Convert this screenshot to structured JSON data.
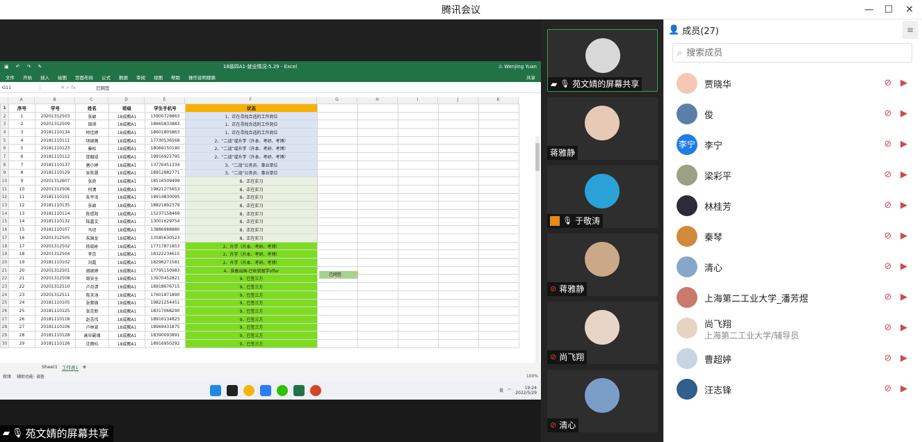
{
  "window": {
    "title": "腾讯会议"
  },
  "share": {
    "label": "苑文婧的屏幕共享"
  },
  "excel": {
    "title": "18级四A1-就业情况-5.29 - Excel",
    "user": "Wenjing Yuan",
    "ribbon": [
      "文件",
      "开始",
      "插入",
      "绘图",
      "页面布局",
      "公式",
      "数据",
      "审阅",
      "视图",
      "帮助",
      "操作说明搜索"
    ],
    "share_btn": "共享",
    "namebox": "G11",
    "formula": "已网签",
    "columns": [
      "A",
      "B",
      "C",
      "D",
      "E",
      "F",
      "G",
      "H",
      "I",
      "J",
      "K"
    ],
    "headers": [
      "序号",
      "学号",
      "姓名",
      "班级",
      "学生手机号",
      "状态"
    ],
    "rows": [
      [
        "1",
        "20201312503",
        "张颖",
        "18成教A1",
        "15900729863",
        "1、正在寻找合适的工作岗位",
        "blue"
      ],
      [
        "2",
        "20201312509",
        "田琪",
        "18成教A1",
        "18665833883",
        "1、正在寻找合适的工作岗位",
        "blue"
      ],
      [
        "3",
        "20181110134",
        "柯佳婷",
        "18成教A1",
        "18601805863",
        "1、正在寻找合适的工作岗位",
        "blue"
      ],
      [
        "4",
        "20181110111",
        "项婉薇",
        "18成教A1",
        "17730536568",
        "2、“二战”或升学（升本、考研、考博）",
        "blue"
      ],
      [
        "5",
        "20181110123",
        "秦松",
        "18成教A1",
        "18069150190",
        "2、“二战”或升学（升本、考研、考博）",
        "blue"
      ],
      [
        "6",
        "20181110112",
        "庞翰成",
        "18成教A1",
        "19916921795",
        "2、“二战”或升学（升本、考研、考博）",
        "blue"
      ],
      [
        "7",
        "20181110137",
        "唐小婷",
        "18成教A1",
        "13776451334",
        "3、“二战”公务员、事业单位",
        "blue"
      ],
      [
        "8",
        "20181110129",
        "吴陈晟",
        "18成教A1",
        "18912882771",
        "3、“二战”公务员、事业单位",
        "blue"
      ],
      [
        "9",
        "20201312607",
        "张奇",
        "18成教A1",
        "18516509499",
        "8、正在实习",
        "light"
      ],
      [
        "10",
        "20201312506",
        "何潇",
        "18成教A1",
        "19821275653",
        "8、正在实习",
        "light"
      ],
      [
        "11",
        "20181110101",
        "朱平泽",
        "18成教A1",
        "18914830095",
        "8、正在实习",
        "light"
      ],
      [
        "12",
        "20181110135",
        "张颖",
        "18成教A1",
        "18821892379",
        "8、正在实习",
        "light"
      ],
      [
        "13",
        "20181110114",
        "陈煜阳",
        "18成教A1",
        "15237158469",
        "8、正在实习",
        "light"
      ],
      [
        "14",
        "20181110132",
        "陆嘉文",
        "18成教A1",
        "13001629754",
        "8、正在实习",
        "light"
      ],
      [
        "15",
        "20181110107",
        "马坦",
        "18成教A1",
        "13886988880",
        "8、正在实习",
        "light"
      ],
      [
        "16",
        "20201312505",
        "朱国龙",
        "18成教A1",
        "13585630523",
        "8、正在实习",
        "light"
      ],
      [
        "17",
        "20201312502",
        "杨晓彬",
        "18成教A1",
        "17717871853",
        "2、升学（升本、考研、考博）",
        "green"
      ],
      [
        "18",
        "20201312504",
        "李京",
        "18成教A1",
        "18122234615",
        "2、升学（升本、考研、考博）",
        "green"
      ],
      [
        "19",
        "20181110102",
        "刘磊",
        "18成教A1",
        "18296271581",
        "2、升学（升本、考研、考博）",
        "green"
      ],
      [
        "20",
        "20201312501",
        "胡婉婷",
        "18成教A1",
        "17795150983",
        "4、准备出国-已收到留学offer",
        "green"
      ],
      [
        "21",
        "20201312508",
        "周安全",
        "18成教A1",
        "13970452821",
        "9、已签三方",
        "green"
      ],
      [
        "22",
        "20201312510",
        "卢月清",
        "18成教A1",
        "18918676715",
        "9、已签三方",
        "green"
      ],
      [
        "23",
        "20201312511",
        "陈天池",
        "18成教A1",
        "17601871890",
        "9、已签三方",
        "green"
      ],
      [
        "24",
        "20181110105",
        "张紫微",
        "18成教A1",
        "19821254451",
        "9、已签三方",
        "green"
      ],
      [
        "25",
        "20181110125",
        "张克新",
        "18成教A1",
        "18317068290",
        "9、已签三方",
        "green"
      ],
      [
        "26",
        "20181110118",
        "赵志伟",
        "18成教A1",
        "18916134825",
        "9、已签三方",
        "green"
      ],
      [
        "27",
        "20181110106",
        "卢林波",
        "18成教A1",
        "18969431875",
        "9、已签三方",
        "green"
      ],
      [
        "28",
        "20181110128",
        "高中副魂",
        "18成教A1",
        "18390093891",
        "9、已签三方",
        "green"
      ],
      [
        "29",
        "20181110126",
        "沈雨杭",
        "18成教A1",
        "18916950292",
        "9、已签三方",
        "green"
      ]
    ],
    "tag": "已网签",
    "sheets": [
      "Sheet1",
      "工作表1"
    ],
    "status_left": "就绪",
    "accessibility": "辅助功能: 调查",
    "zoom": "100%",
    "clock_time": "19:24",
    "clock_date": "2022/5/29",
    "ime": "英"
  },
  "videos": [
    {
      "name": "苑文婧的屏幕共享",
      "mic": "on",
      "share": true,
      "color": "#d9d9d9"
    },
    {
      "name": "蒋雅静",
      "mic": "none",
      "color": "#e8c9b5"
    },
    {
      "name": "于敬涛",
      "mic": "on",
      "box": true,
      "color": "#2aa2d8"
    },
    {
      "name": "蒋雅静",
      "mic": "muted",
      "color": "#caa988"
    },
    {
      "name": "尚飞翔",
      "mic": "muted",
      "color": "#e7d6c8"
    },
    {
      "name": "清心",
      "mic": "muted",
      "color": "#7a9ec8"
    }
  ],
  "panel": {
    "title": "成员(27)",
    "search_placeholder": "搜索成员",
    "members": [
      {
        "name": "贾晓华",
        "sub": "",
        "avatar_text": "",
        "color": "#f5c7b4"
      },
      {
        "name": "俊",
        "sub": "",
        "avatar_text": "",
        "color": "#5b7fa8"
      },
      {
        "name": "李宁",
        "sub": "",
        "avatar_text": "李宁",
        "color": "#1e7de8"
      },
      {
        "name": "梁彩平",
        "sub": "",
        "avatar_text": "",
        "color": "#9aa184"
      },
      {
        "name": "林桂芳",
        "sub": "",
        "avatar_text": "",
        "color": "#2f2a3a"
      },
      {
        "name": "秦琴",
        "sub": "",
        "avatar_text": "",
        "color": "#d08a3a"
      },
      {
        "name": "清心",
        "sub": "",
        "avatar_text": "",
        "color": "#87a6c9"
      },
      {
        "name": "上海第二工业大学_潘芳煜",
        "sub": "",
        "avatar_text": "",
        "color": "#c97a6a"
      },
      {
        "name": "尚飞翔",
        "sub": "上海第二工业大学/辅导员",
        "avatar_text": "",
        "color": "#e6d3c2"
      },
      {
        "name": "曹超婷",
        "sub": "",
        "avatar_text": "",
        "color": "#c6d4e4"
      },
      {
        "name": "汪志锋",
        "sub": "",
        "avatar_text": "",
        "color": "#2f5f8a"
      }
    ]
  }
}
